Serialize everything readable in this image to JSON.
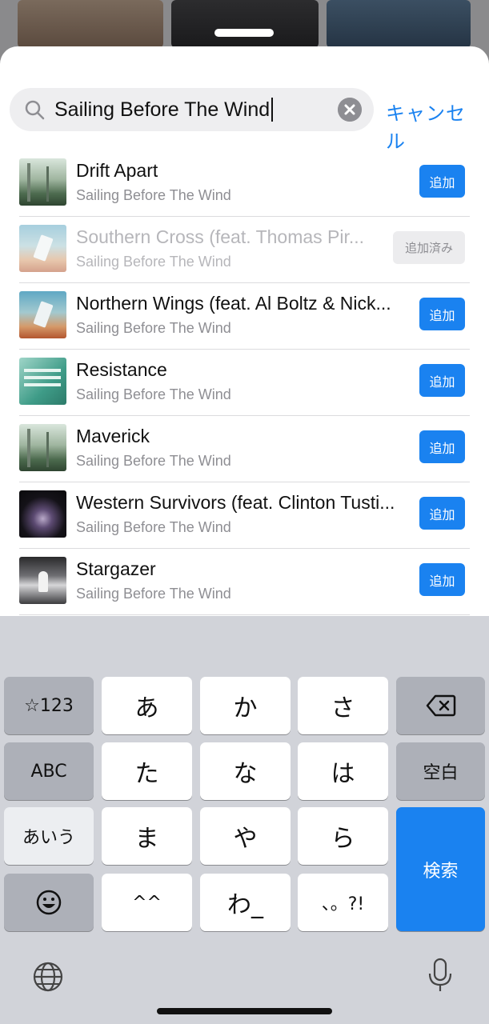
{
  "search": {
    "value": "Sailing Before The Wind",
    "cancel_label": "キャンセル"
  },
  "songs": [
    {
      "title": "Drift Apart",
      "artist": "Sailing Before The Wind",
      "action": "追加"
    },
    {
      "title": "Southern Cross (feat. Thomas Pir...",
      "artist": "Sailing Before The Wind",
      "action": "追加済み"
    },
    {
      "title": "Northern Wings (feat. Al Boltz & Nick...",
      "artist": "Sailing Before The Wind",
      "action": "追加"
    },
    {
      "title": "Resistance",
      "artist": "Sailing Before The Wind",
      "action": "追加"
    },
    {
      "title": "Maverick",
      "artist": "Sailing Before The Wind",
      "action": "追加"
    },
    {
      "title": "Western Survivors (feat. Clinton Tusti...",
      "artist": "Sailing Before The Wind",
      "action": "追加"
    },
    {
      "title": "Stargazer",
      "artist": "Sailing Before The Wind",
      "action": "追加"
    }
  ],
  "keyboard": {
    "row1": [
      "☆123",
      "あ",
      "か",
      "さ"
    ],
    "row2": [
      "ABC",
      "た",
      "な",
      "は",
      "空白"
    ],
    "row3": [
      "あいう",
      "ま",
      "や",
      "ら"
    ],
    "row4": [
      "^^",
      "わ_",
      "、。?!"
    ],
    "search_key": "検索"
  },
  "colors": {
    "accent": "#1a82f0",
    "keyboard_bg": "#d1d3d9"
  }
}
